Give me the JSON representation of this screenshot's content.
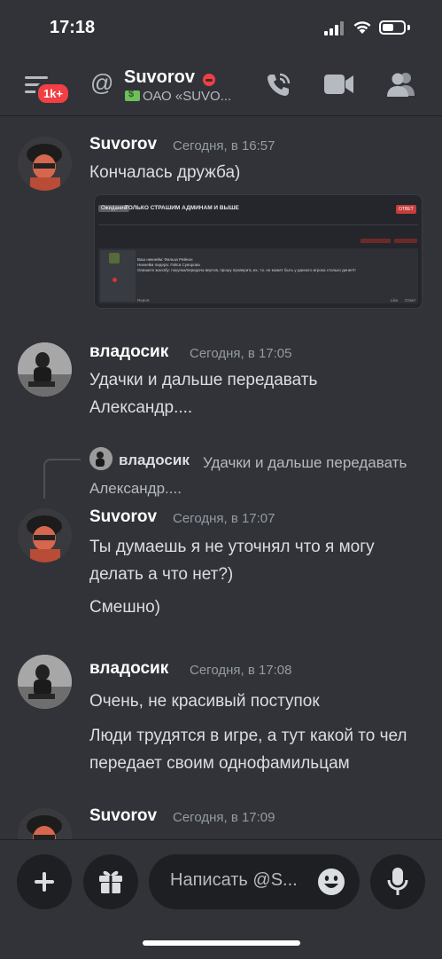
{
  "status_bar": {
    "time": "17:18"
  },
  "header": {
    "badge": "1k+",
    "name": "Suvorov",
    "status": "ОАО «SUVO..."
  },
  "attachment": {
    "status_tag": "Ожидание",
    "title": "ТОЛЬКО СТРАШИМ АДМИНАМ И ВЫШЕ",
    "reply_button": "ОТВЕТ",
    "post_lines": [
      "Ваш никнейм: Фильза Рейнон",
      "Никнейм лидера: Гейса Суворова",
      "Опишите жалобу: покупка/передача вертов, прошу проверить их, т.к. не может быть у данного игрока столько денег!!!"
    ],
    "report": "Report",
    "like": "Like",
    "reply": "Ответ"
  },
  "messages": [
    {
      "user": "Suvorov",
      "time": "Сегодня, в 16:57",
      "lines": [
        "Кончалась дружба)"
      ]
    },
    {
      "user": "владосик",
      "time": "Сегодня, в 17:05",
      "lines": [
        "Удачки и дальше передавать Александр...."
      ]
    },
    {
      "user": "Suvorov",
      "time": "Сегодня, в 17:07",
      "lines": [
        "Ты думаешь я не уточнял что я могу делать а что нет?)",
        "Смешно)"
      ]
    },
    {
      "user": "владосик",
      "time": "Сегодня, в 17:08",
      "lines": [
        "Очень, не красивый поступок",
        "Люди трудятся в игре, а тут какой то чел передает своим однофамильцам"
      ]
    },
    {
      "user": "Suvorov",
      "time": "Сегодня, в 17:09",
      "lines": []
    }
  ],
  "reply_preview": {
    "user": "владосик",
    "text": "Удачки и дальше передавать Александр...."
  },
  "composer": {
    "placeholder": "Написать @S..."
  },
  "colors": {
    "background": "#313338",
    "accent_red": "#f23f43",
    "input_bg": "#1e1f22"
  },
  "icons": [
    "threads-icon",
    "at-icon",
    "phone-icon",
    "video-icon",
    "members-icon",
    "plus-icon",
    "gift-icon",
    "emoji-icon",
    "mic-icon"
  ]
}
